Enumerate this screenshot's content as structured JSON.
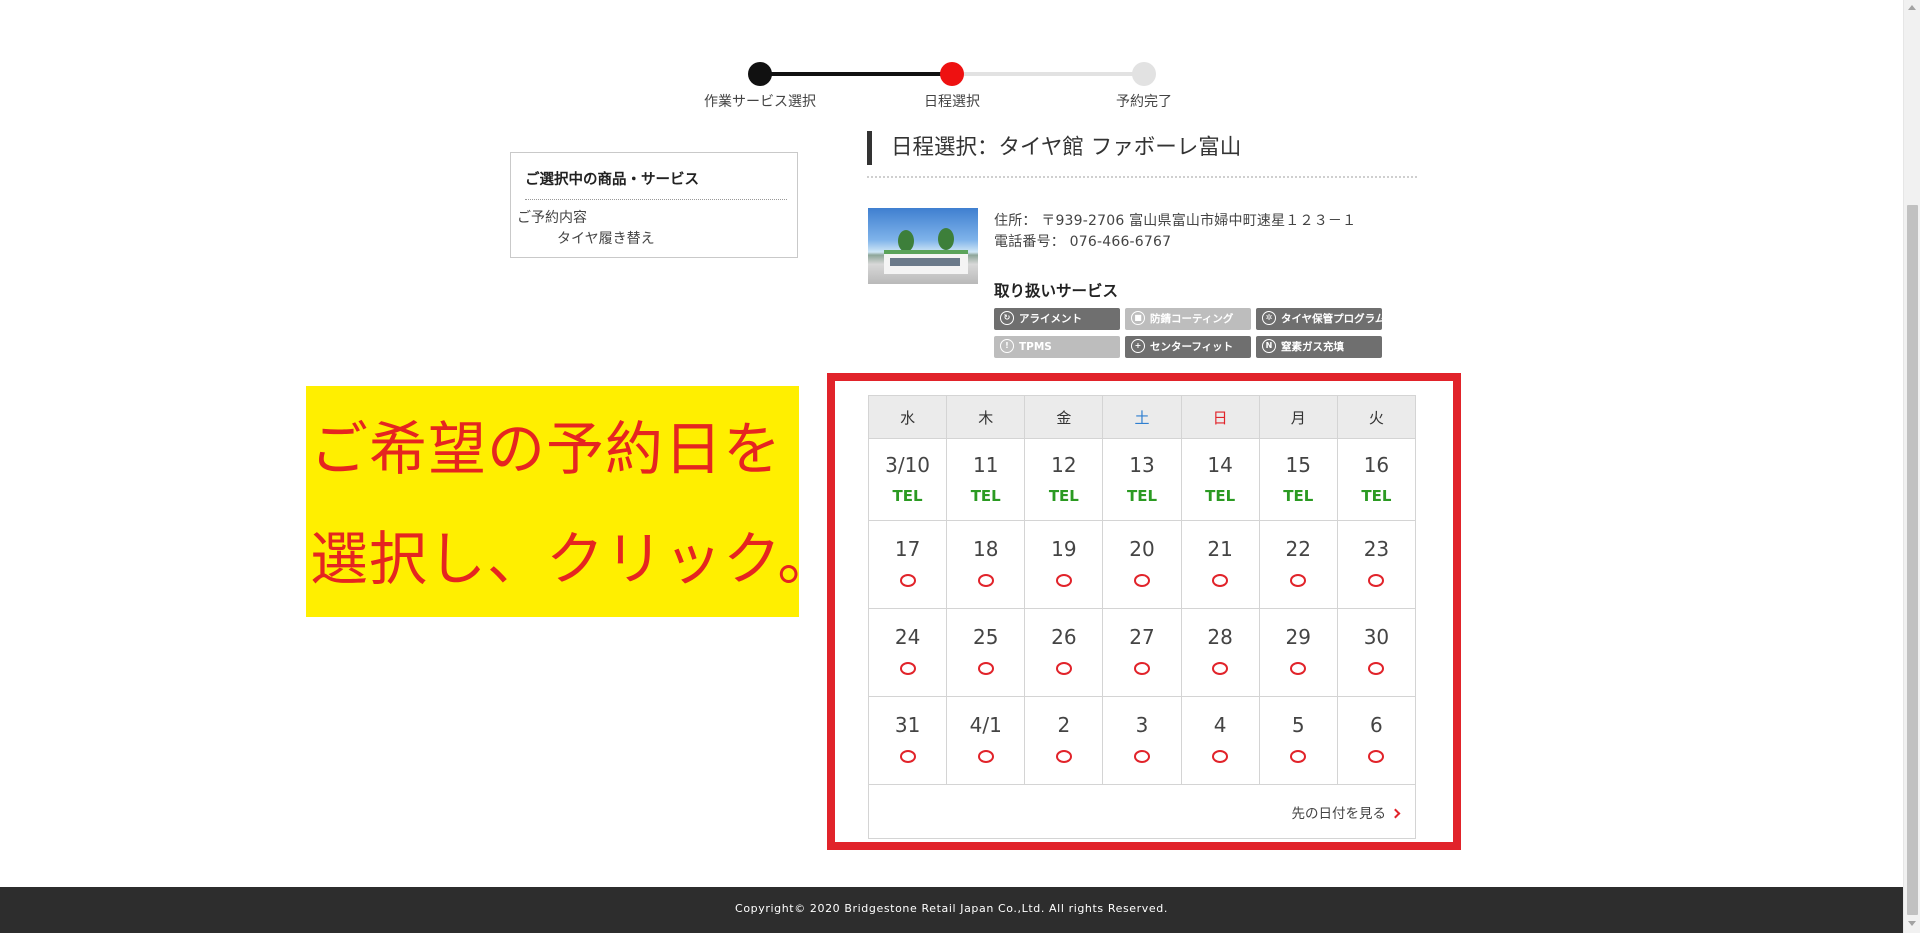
{
  "stepper": {
    "steps": [
      {
        "label": "作業サービス選択",
        "color": "#111111"
      },
      {
        "label": "日程選択",
        "color": "#ee1111"
      },
      {
        "label": "予約完了",
        "color": "#e2e2e2"
      }
    ],
    "current_step": 2
  },
  "selection": {
    "title": "ご選択中の商品・サービス",
    "label": "ご予約内容",
    "value": "タイヤ履き替え"
  },
  "heading": "日程選択：タイヤ館 ファボーレ富山",
  "shop": {
    "address": "住所： 〒939-2706 富山県富山市婦中町速星１２３－１",
    "phone": "電話番号： 076-466-6767",
    "services_title": "取り扱いサービス",
    "services": [
      {
        "label": "アライメント",
        "enabled": true,
        "icon": "alignment-icon"
      },
      {
        "label": "防錆コーティング",
        "enabled": false,
        "icon": "coating-icon"
      },
      {
        "label": "タイヤ保管プログラム",
        "enabled": true,
        "icon": "tire-storage-icon"
      },
      {
        "label": "TPMS",
        "enabled": false,
        "icon": "tpms-icon"
      },
      {
        "label": "センターフィット",
        "enabled": true,
        "icon": "center-fit-icon"
      },
      {
        "label": "窒素ガス充填",
        "enabled": true,
        "icon": "nitrogen-icon"
      }
    ]
  },
  "note": {
    "line1": "ご希望の予約日を",
    "line2": "選択し、クリック。"
  },
  "calendar": {
    "weekdays": [
      "水",
      "木",
      "金",
      "土",
      "日",
      "月",
      "火"
    ],
    "weekday_colors": [
      "#333333",
      "#333333",
      "#333333",
      "#2f7fd0",
      "#e1232a",
      "#333333",
      "#333333"
    ],
    "weeks": [
      [
        {
          "day": "3/10",
          "status": "TEL"
        },
        {
          "day": "11",
          "status": "TEL"
        },
        {
          "day": "12",
          "status": "TEL"
        },
        {
          "day": "13",
          "status": "TEL"
        },
        {
          "day": "14",
          "status": "TEL"
        },
        {
          "day": "15",
          "status": "TEL"
        },
        {
          "day": "16",
          "status": "TEL"
        }
      ],
      [
        {
          "day": "17",
          "status": "available"
        },
        {
          "day": "18",
          "status": "available"
        },
        {
          "day": "19",
          "status": "available"
        },
        {
          "day": "20",
          "status": "available"
        },
        {
          "day": "21",
          "status": "available"
        },
        {
          "day": "22",
          "status": "available"
        },
        {
          "day": "23",
          "status": "available"
        }
      ],
      [
        {
          "day": "24",
          "status": "available"
        },
        {
          "day": "25",
          "status": "available"
        },
        {
          "day": "26",
          "status": "available"
        },
        {
          "day": "27",
          "status": "available"
        },
        {
          "day": "28",
          "status": "available"
        },
        {
          "day": "29",
          "status": "available"
        },
        {
          "day": "30",
          "status": "available"
        }
      ],
      [
        {
          "day": "31",
          "status": "available"
        },
        {
          "day": "4/1",
          "status": "available"
        },
        {
          "day": "2",
          "status": "available"
        },
        {
          "day": "3",
          "status": "available"
        },
        {
          "day": "4",
          "status": "available"
        },
        {
          "day": "5",
          "status": "available"
        },
        {
          "day": "6",
          "status": "available"
        }
      ]
    ],
    "next_link": "先の日付を見る"
  },
  "footer": {
    "copyright": "Copyright© 2020 Bridgestone Retail Japan Co.,Ltd. All rights Reserved."
  }
}
